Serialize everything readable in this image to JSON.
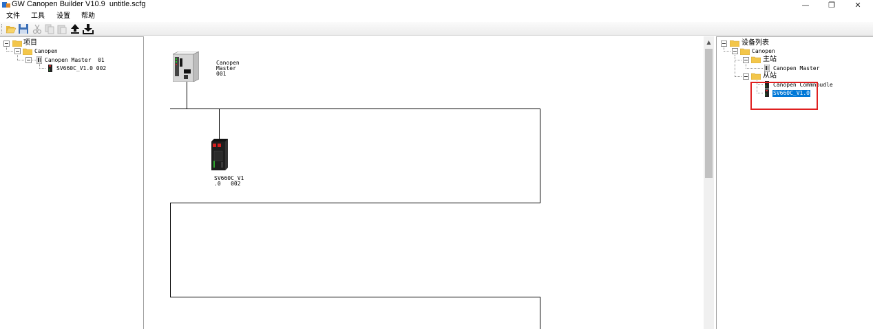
{
  "window": {
    "title": "GW Canopen Builder V10.9  untitle.scfg",
    "minimize": "—",
    "maximize": "❐",
    "close": "✕"
  },
  "menu": [
    "文件",
    "工具",
    "设置",
    "帮助"
  ],
  "toolbar": {
    "buttons": [
      "open-folder-icon",
      "save-icon",
      "cut-icon",
      "copy-icon",
      "paste-icon",
      "upload-icon",
      "download-icon"
    ]
  },
  "project_tree": {
    "root": "项目",
    "canopen": "Canopen",
    "master": "Canopen Master  01",
    "slave": "SV660C_V1.0 002"
  },
  "canvas": {
    "master_label": "Canopen\nMaster\n001",
    "slave_label": "SV660C_V1\n.0   002"
  },
  "device_list": {
    "root": "设备列表",
    "canopen": "Canopen",
    "master_group": "主站",
    "master_item": "Canopen Master",
    "slave_group": "从站",
    "slave_item1": "Canopen Commnoudle",
    "slave_item2": "SV660C_V1.0"
  },
  "colors": {
    "selection": "#0078d7",
    "highlight_box": "#e02020",
    "folder": "#f3c64a"
  }
}
